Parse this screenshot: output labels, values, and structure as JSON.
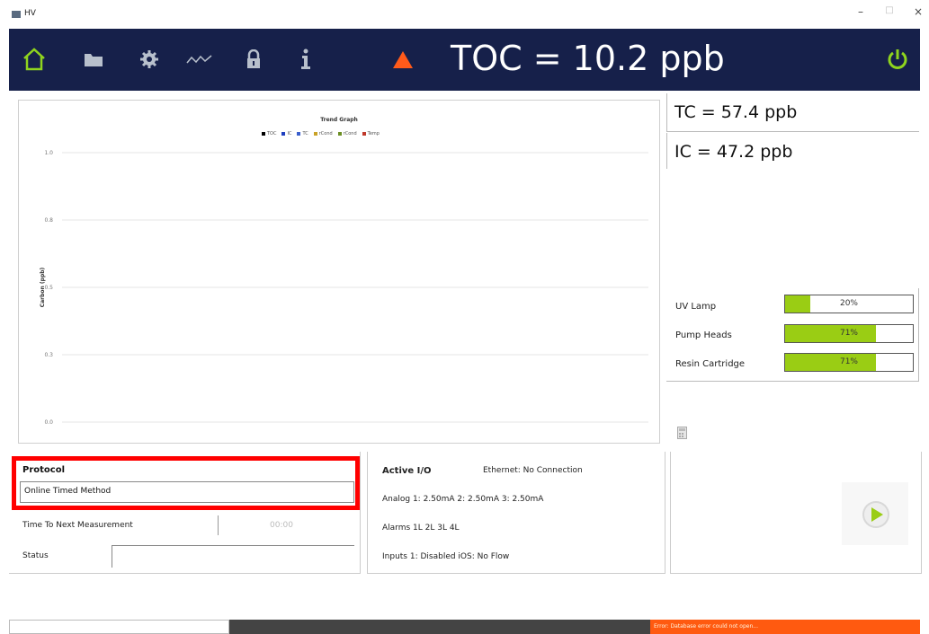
{
  "window": {
    "title": "HV",
    "minimize": "–",
    "maximize": "□",
    "close": "×"
  },
  "header": {
    "icons": [
      "home-icon",
      "folder-icon",
      "gear-icon",
      "trend-icon",
      "lock-icon",
      "info-icon",
      "warning-icon",
      "power-icon"
    ],
    "toc_reading": "TOC = 10.2 ppb",
    "colors": {
      "background": "#16204a",
      "home": "#8fd41e",
      "warning": "#ff5a1a",
      "power": "#8fd41e"
    }
  },
  "readings": {
    "tc": "TC = 57.4 ppb",
    "ic": "IC = 47.2 ppb"
  },
  "chart_data": {
    "type": "line",
    "title": "Trend Graph",
    "ylabel": "Carbon (ppb)",
    "legend": [
      {
        "name": "TOC",
        "color": "#000000"
      },
      {
        "name": "IC",
        "color": "#1f3fbf"
      },
      {
        "name": "TC",
        "color": "#3a5fcd"
      },
      {
        "name": "rCond",
        "color": "#c9a227"
      },
      {
        "name": "rCond",
        "color": "#6b8e23"
      },
      {
        "name": "Temp",
        "color": "#c0392b"
      }
    ],
    "yticks": [
      "1.0",
      "0.8",
      "0.5",
      "0.3",
      "0.0"
    ],
    "ylim": [
      0,
      1
    ],
    "grid": true,
    "series": []
  },
  "consumables": [
    {
      "label": "UV Lamp",
      "percent": 20,
      "text": "20%"
    },
    {
      "label": "Pump Heads",
      "percent": 71,
      "text": "71%"
    },
    {
      "label": "Resin Cartridge",
      "percent": 71,
      "text": "71%"
    }
  ],
  "protocol": {
    "label": "Protocol",
    "value": "Online Timed Method",
    "time_label": "Time To Next Measurement",
    "time_value": "00:00",
    "status_label": "Status",
    "status_value": ""
  },
  "io": {
    "title": "Active I/O",
    "ethernet": "Ethernet: No Connection",
    "analog": "Analog 1: 2.50mA  2: 2.50mA  3: 2.50mA",
    "alarms": "Alarms 1L 2L 3L 4L",
    "inputs": "Inputs 1: Disabled  iOS: No Flow"
  },
  "status_bar": {
    "error": "Error: Database error could not open..."
  }
}
